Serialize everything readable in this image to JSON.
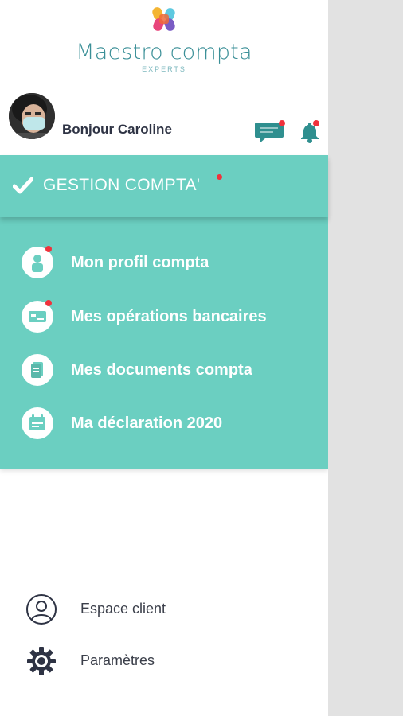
{
  "brand": {
    "name": "Maestro compta",
    "subtitle": "EXPERTS",
    "colors": {
      "teal": "#6bcfc1",
      "logo_text": "#3a8f97",
      "dot": "#f0323c"
    }
  },
  "header": {
    "greeting": "Bonjour Caroline",
    "icons": [
      "chat-icon",
      "bell-icon"
    ]
  },
  "section": {
    "title": "GESTION COMPTA'",
    "icon": "check-icon"
  },
  "menu": {
    "items": [
      {
        "label": "Mon profil compta",
        "icon": "user-profile-icon",
        "badge": true
      },
      {
        "label": "Mes opérations bancaires",
        "icon": "bank-card-icon",
        "badge": true
      },
      {
        "label": "Mes documents compta",
        "icon": "document-icon",
        "badge": false
      },
      {
        "label": "Ma déclaration 2020",
        "icon": "calendar-icon",
        "badge": false
      }
    ]
  },
  "footer": {
    "items": [
      {
        "label": "Espace client",
        "icon": "person-circle-icon"
      },
      {
        "label": "Paramètres",
        "icon": "gear-icon"
      }
    ]
  }
}
